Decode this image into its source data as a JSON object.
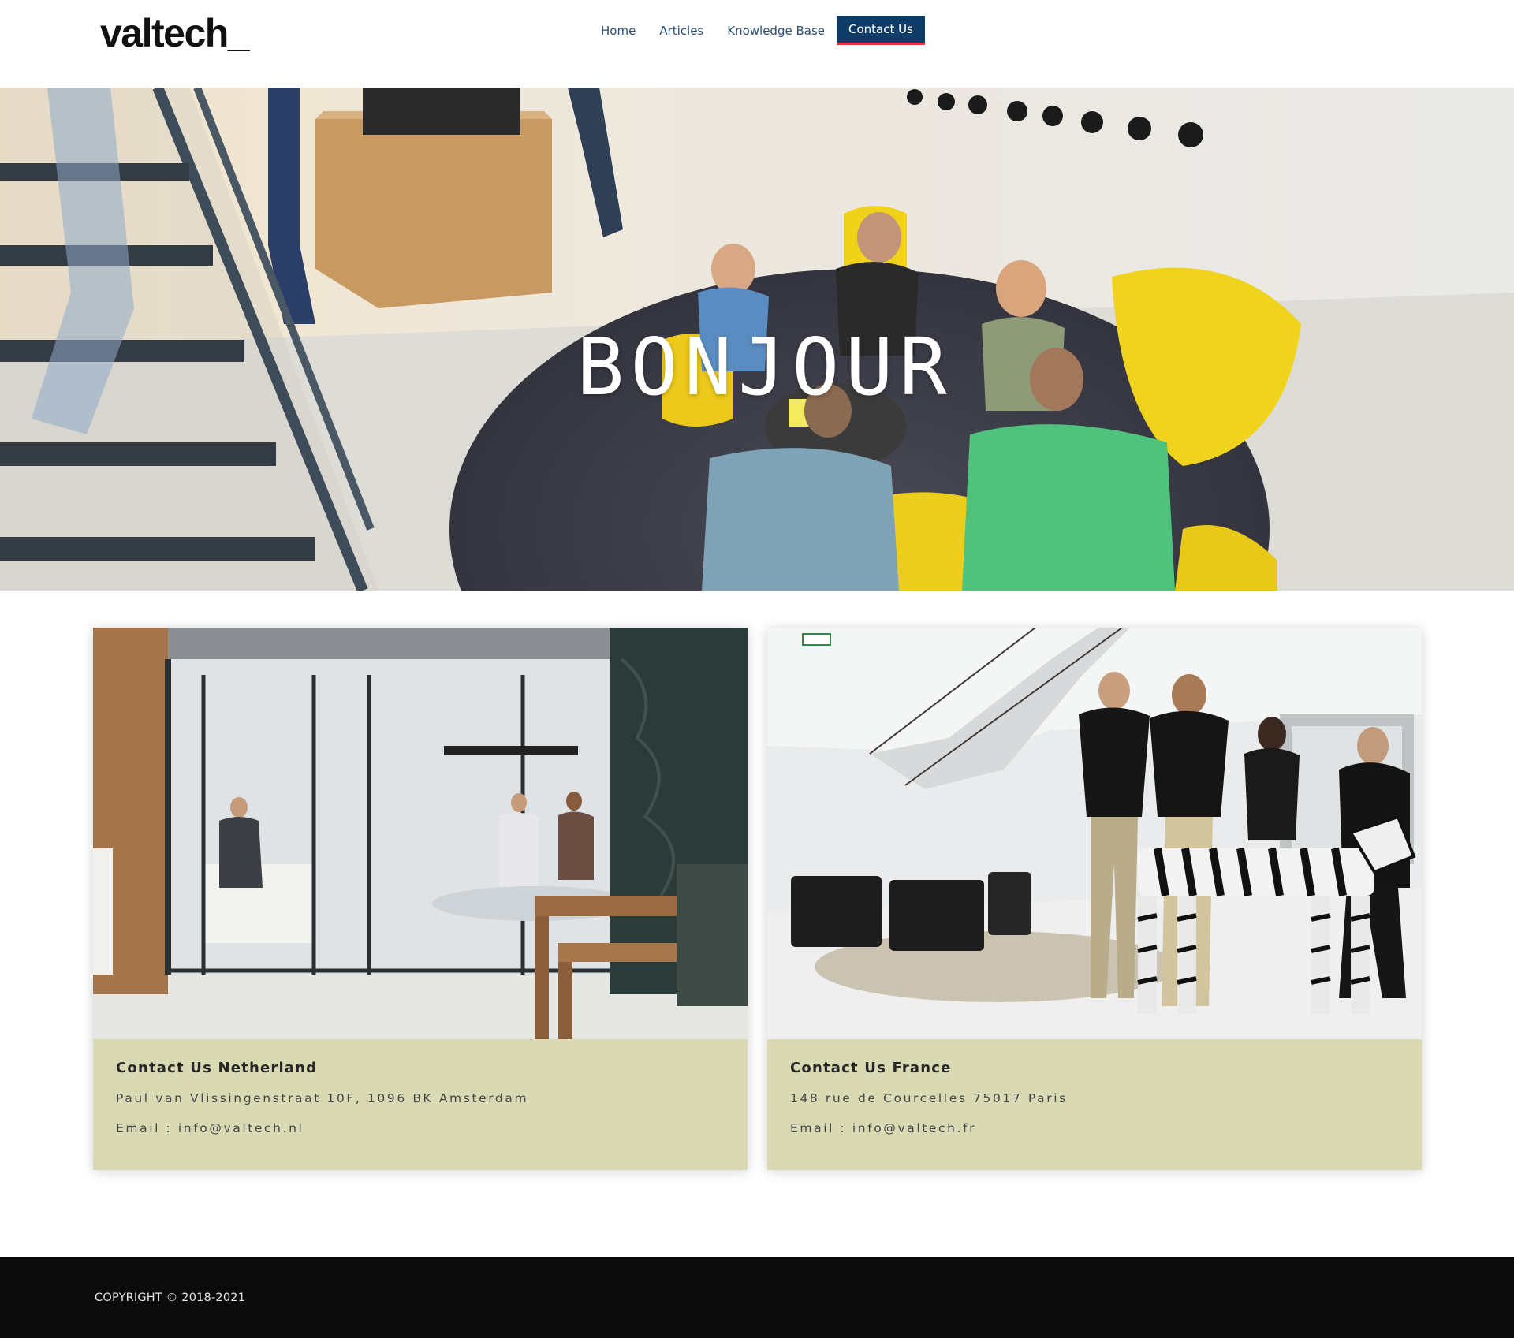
{
  "header": {
    "logo": "valtech_",
    "nav": [
      {
        "label": "Home"
      },
      {
        "label": "Articles"
      },
      {
        "label": "Knowledge Base"
      },
      {
        "label": "Contact Us",
        "active": true
      }
    ]
  },
  "hero": {
    "title": "BONJOUR"
  },
  "contacts": {
    "netherland": {
      "title": "Contact Us Netherland",
      "address": "Paul van Vlissingenstraat 10F, 1096 BK Amsterdam",
      "email": "Email : info@valtech.nl"
    },
    "france": {
      "title": "Contact Us France",
      "address": "148 rue de Courcelles 75017 Paris",
      "email": "Email : info@valtech.fr"
    }
  },
  "footer": {
    "copyright": "COPYRIGHT © 2018-2021"
  },
  "colors": {
    "nav_text": "#2c4f73",
    "nav_active_bg": "#0f3c66",
    "nav_active_underline": "#e23c3c",
    "card_bg": "#d9d9b4",
    "footer_bg": "#0b0b0b"
  }
}
